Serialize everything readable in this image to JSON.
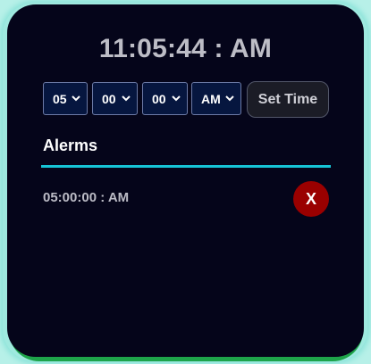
{
  "clock": {
    "time": "11:05:44 : AM"
  },
  "time_picker": {
    "hour": "05",
    "minute": "00",
    "second": "00",
    "period": "AM",
    "set_label": "Set Time"
  },
  "alarms": {
    "heading": "Alerms",
    "items": [
      {
        "time": "05:00:00 : AM",
        "delete_label": "X"
      }
    ]
  },
  "colors": {
    "card_background": "#05051a",
    "accent_divider": "#16c4d6",
    "delete_button": "#9a0000",
    "frame_glow": "#9fe9df",
    "frame_bottom": "#1ea44a",
    "select_background": "#06163f"
  },
  "icons": {
    "dropdown": "chevron-down-icon"
  }
}
